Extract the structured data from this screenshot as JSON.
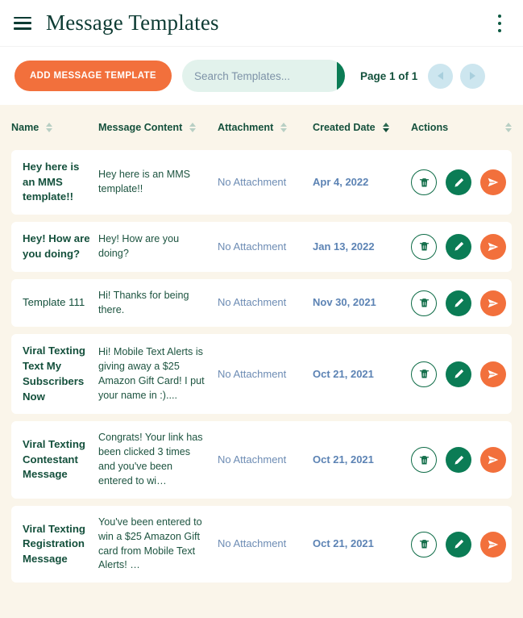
{
  "appbar": {
    "menu_icon": "hamburger-icon",
    "title": "Message Templates",
    "overflow_icon": "kebab-menu-icon"
  },
  "toolbar": {
    "add_button_label": "ADD MESSAGE TEMPLATE",
    "search_placeholder": "Search Templates...",
    "search_value": "",
    "search_icon": "search-icon",
    "page_label": "Page 1 of 1",
    "prev_icon": "chevron-left-icon",
    "next_icon": "chevron-right-icon"
  },
  "table": {
    "columns": [
      {
        "label": "Name",
        "sortable": true,
        "active": false
      },
      {
        "label": "Message Content",
        "sortable": true,
        "active": false
      },
      {
        "label": "Attachment",
        "sortable": true,
        "active": false
      },
      {
        "label": "Created Date",
        "sortable": true,
        "active": true
      },
      {
        "label": "Actions",
        "sortable": true,
        "active": false
      }
    ],
    "actions": {
      "delete_icon": "trash-icon",
      "edit_icon": "pencil-icon",
      "send_icon": "send-icon"
    },
    "rows": [
      {
        "name": "Hey here is an MMS template!!",
        "message": "Hey here is an MMS template!!",
        "attachment": "No Attachment",
        "created_date": "Apr 4, 2022"
      },
      {
        "name": "Hey! How are you doing?",
        "message": "Hey! How are you doing?",
        "attachment": "No Attachment",
        "created_date": "Jan 13, 2022"
      },
      {
        "name": "Template 111",
        "message": "Hi! Thanks for being there.",
        "attachment": "No Attachment",
        "created_date": "Nov 30, 2021"
      },
      {
        "name": "Viral Texting Text My Subscribers Now",
        "message": "Hi! Mobile Text Alerts is giving away a $25 Amazon Gift Card! I put your name in :)....",
        "attachment": "No Attachment",
        "created_date": "Oct 21, 2021"
      },
      {
        "name": "Viral Texting Contestant Message",
        "message": "Congrats! Your link has been clicked 3 times and you've been entered to wi…",
        "attachment": "No Attachment",
        "created_date": "Oct 21, 2021"
      },
      {
        "name": "Viral Texting Registration Message",
        "message": "You've been entered to win a $25 Amazon Gift card from Mobile Text Alerts! …",
        "attachment": "No Attachment",
        "created_date": "Oct 21, 2021"
      }
    ]
  },
  "colors": {
    "accent_orange": "#f2703c",
    "brand_green": "#0b7c55",
    "dark_green": "#14503c",
    "page_bg": "#faf5ea",
    "search_bg": "#e2f2ec",
    "pager_bg": "#cde6ef",
    "link_blue": "#5c83b4"
  }
}
